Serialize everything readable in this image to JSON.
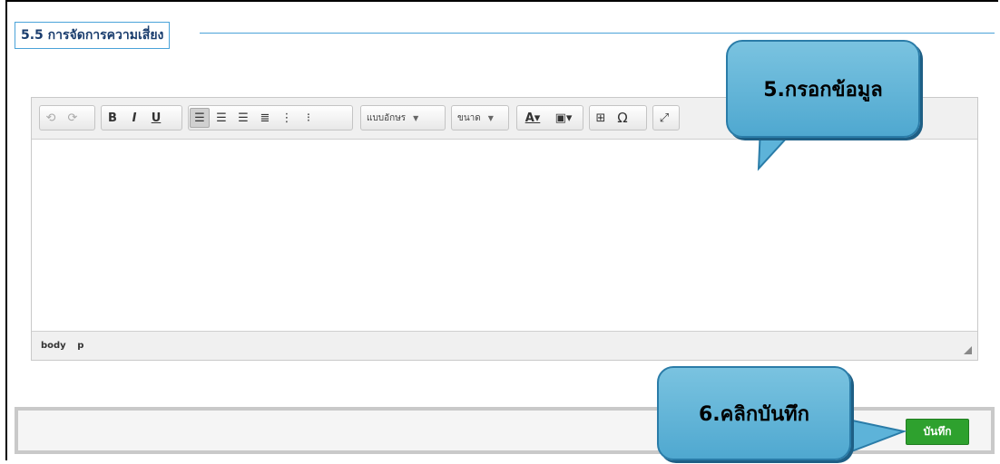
{
  "section": {
    "title": "5.5 การจัดการความเสี่ยง"
  },
  "toolbar": {
    "font_dropdown": "แบบอักษร",
    "size_dropdown": "ขนาด",
    "bold": "B",
    "italic": "I",
    "underline": "U",
    "special_char": "Ω"
  },
  "statusbar": {
    "path": [
      "body",
      "p"
    ]
  },
  "footer": {
    "save_label": "บันทึก"
  },
  "callouts": {
    "step5": "5.กรอกข้อมูล",
    "step6": "6.คลิกบันทึก"
  },
  "colors": {
    "accent": "#4aa3d9",
    "callout": "#5db3d9",
    "save": "#2ea12e"
  }
}
